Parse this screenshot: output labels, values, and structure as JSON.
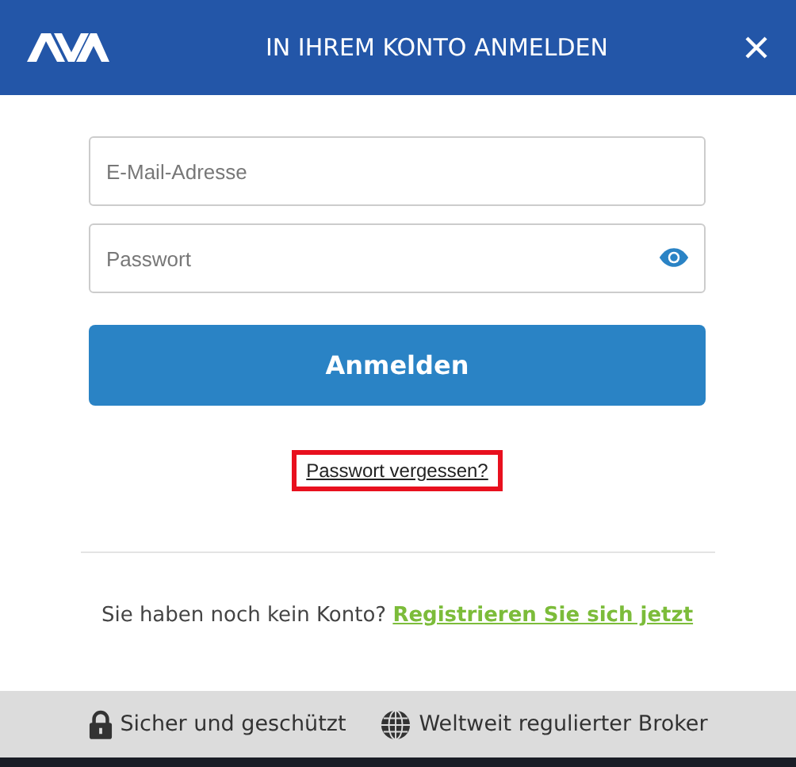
{
  "dialog": {
    "title": "IN IHREM KONTO ANMELDEN"
  },
  "fields": [
    {
      "kind": "email",
      "placeholder": "E-Mail-Adresse"
    },
    {
      "kind": "password",
      "placeholder": "Passwort"
    }
  ],
  "submit_button": "Anmelden",
  "forgot_link": {
    "label": "Passwort vergessen?",
    "highlighted": true
  },
  "register": {
    "prompt": "Sie haben noch kein Konto?",
    "link": "Registrieren Sie sich jetzt"
  },
  "footer": [
    {
      "kind": "lock",
      "label": "Sicher und geschützt"
    },
    {
      "kind": "globe",
      "label": "Weltweit regulierter Broker"
    }
  ]
}
